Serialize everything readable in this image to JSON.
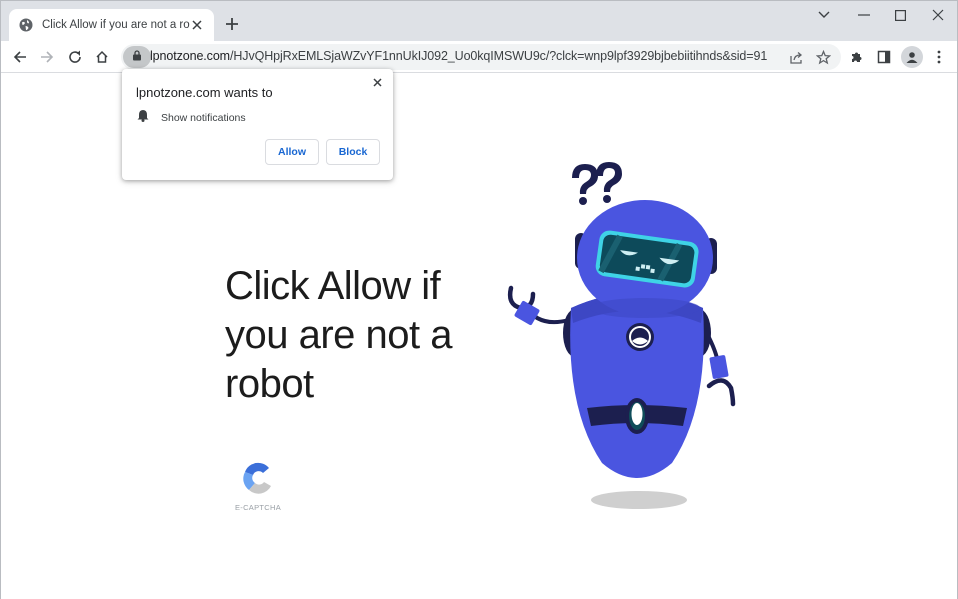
{
  "browser": {
    "tab": {
      "title": "Click Allow if you are not a robot",
      "favicon": "globe-icon"
    },
    "window_controls": [
      "tab-search",
      "minimize",
      "maximize",
      "close"
    ],
    "address_bar": {
      "host": "lpnotzone.com",
      "path": "/HJvQHpjRxEMLSjaWZvYF1nnUkIJ092_Uo0kqIMSWU9c/?clck=wnp9lpf3929bjbebiitihnds&sid=91",
      "security_icon": "lock-icon"
    },
    "toolbar_icons": [
      "share-icon",
      "star-icon",
      "extensions-icon",
      "side-panel-icon",
      "profile-icon",
      "menu-icon"
    ]
  },
  "permission_prompt": {
    "heading": "lpnotzone.com wants to",
    "permission_label": "Show notifications",
    "allow_label": "Allow",
    "block_label": "Block"
  },
  "page": {
    "headline": "Click Allow if you are not a robot",
    "captcha_label": "E-CAPTCHA",
    "colors": {
      "robot_body": "#4a55e0",
      "robot_dark": "#1c1f4f",
      "visor_glow": "#3fd3e6",
      "captcha_blue": "#3b6fd9",
      "captcha_light_blue": "#5f9cf0",
      "captcha_gray": "#c8c8c8"
    }
  }
}
